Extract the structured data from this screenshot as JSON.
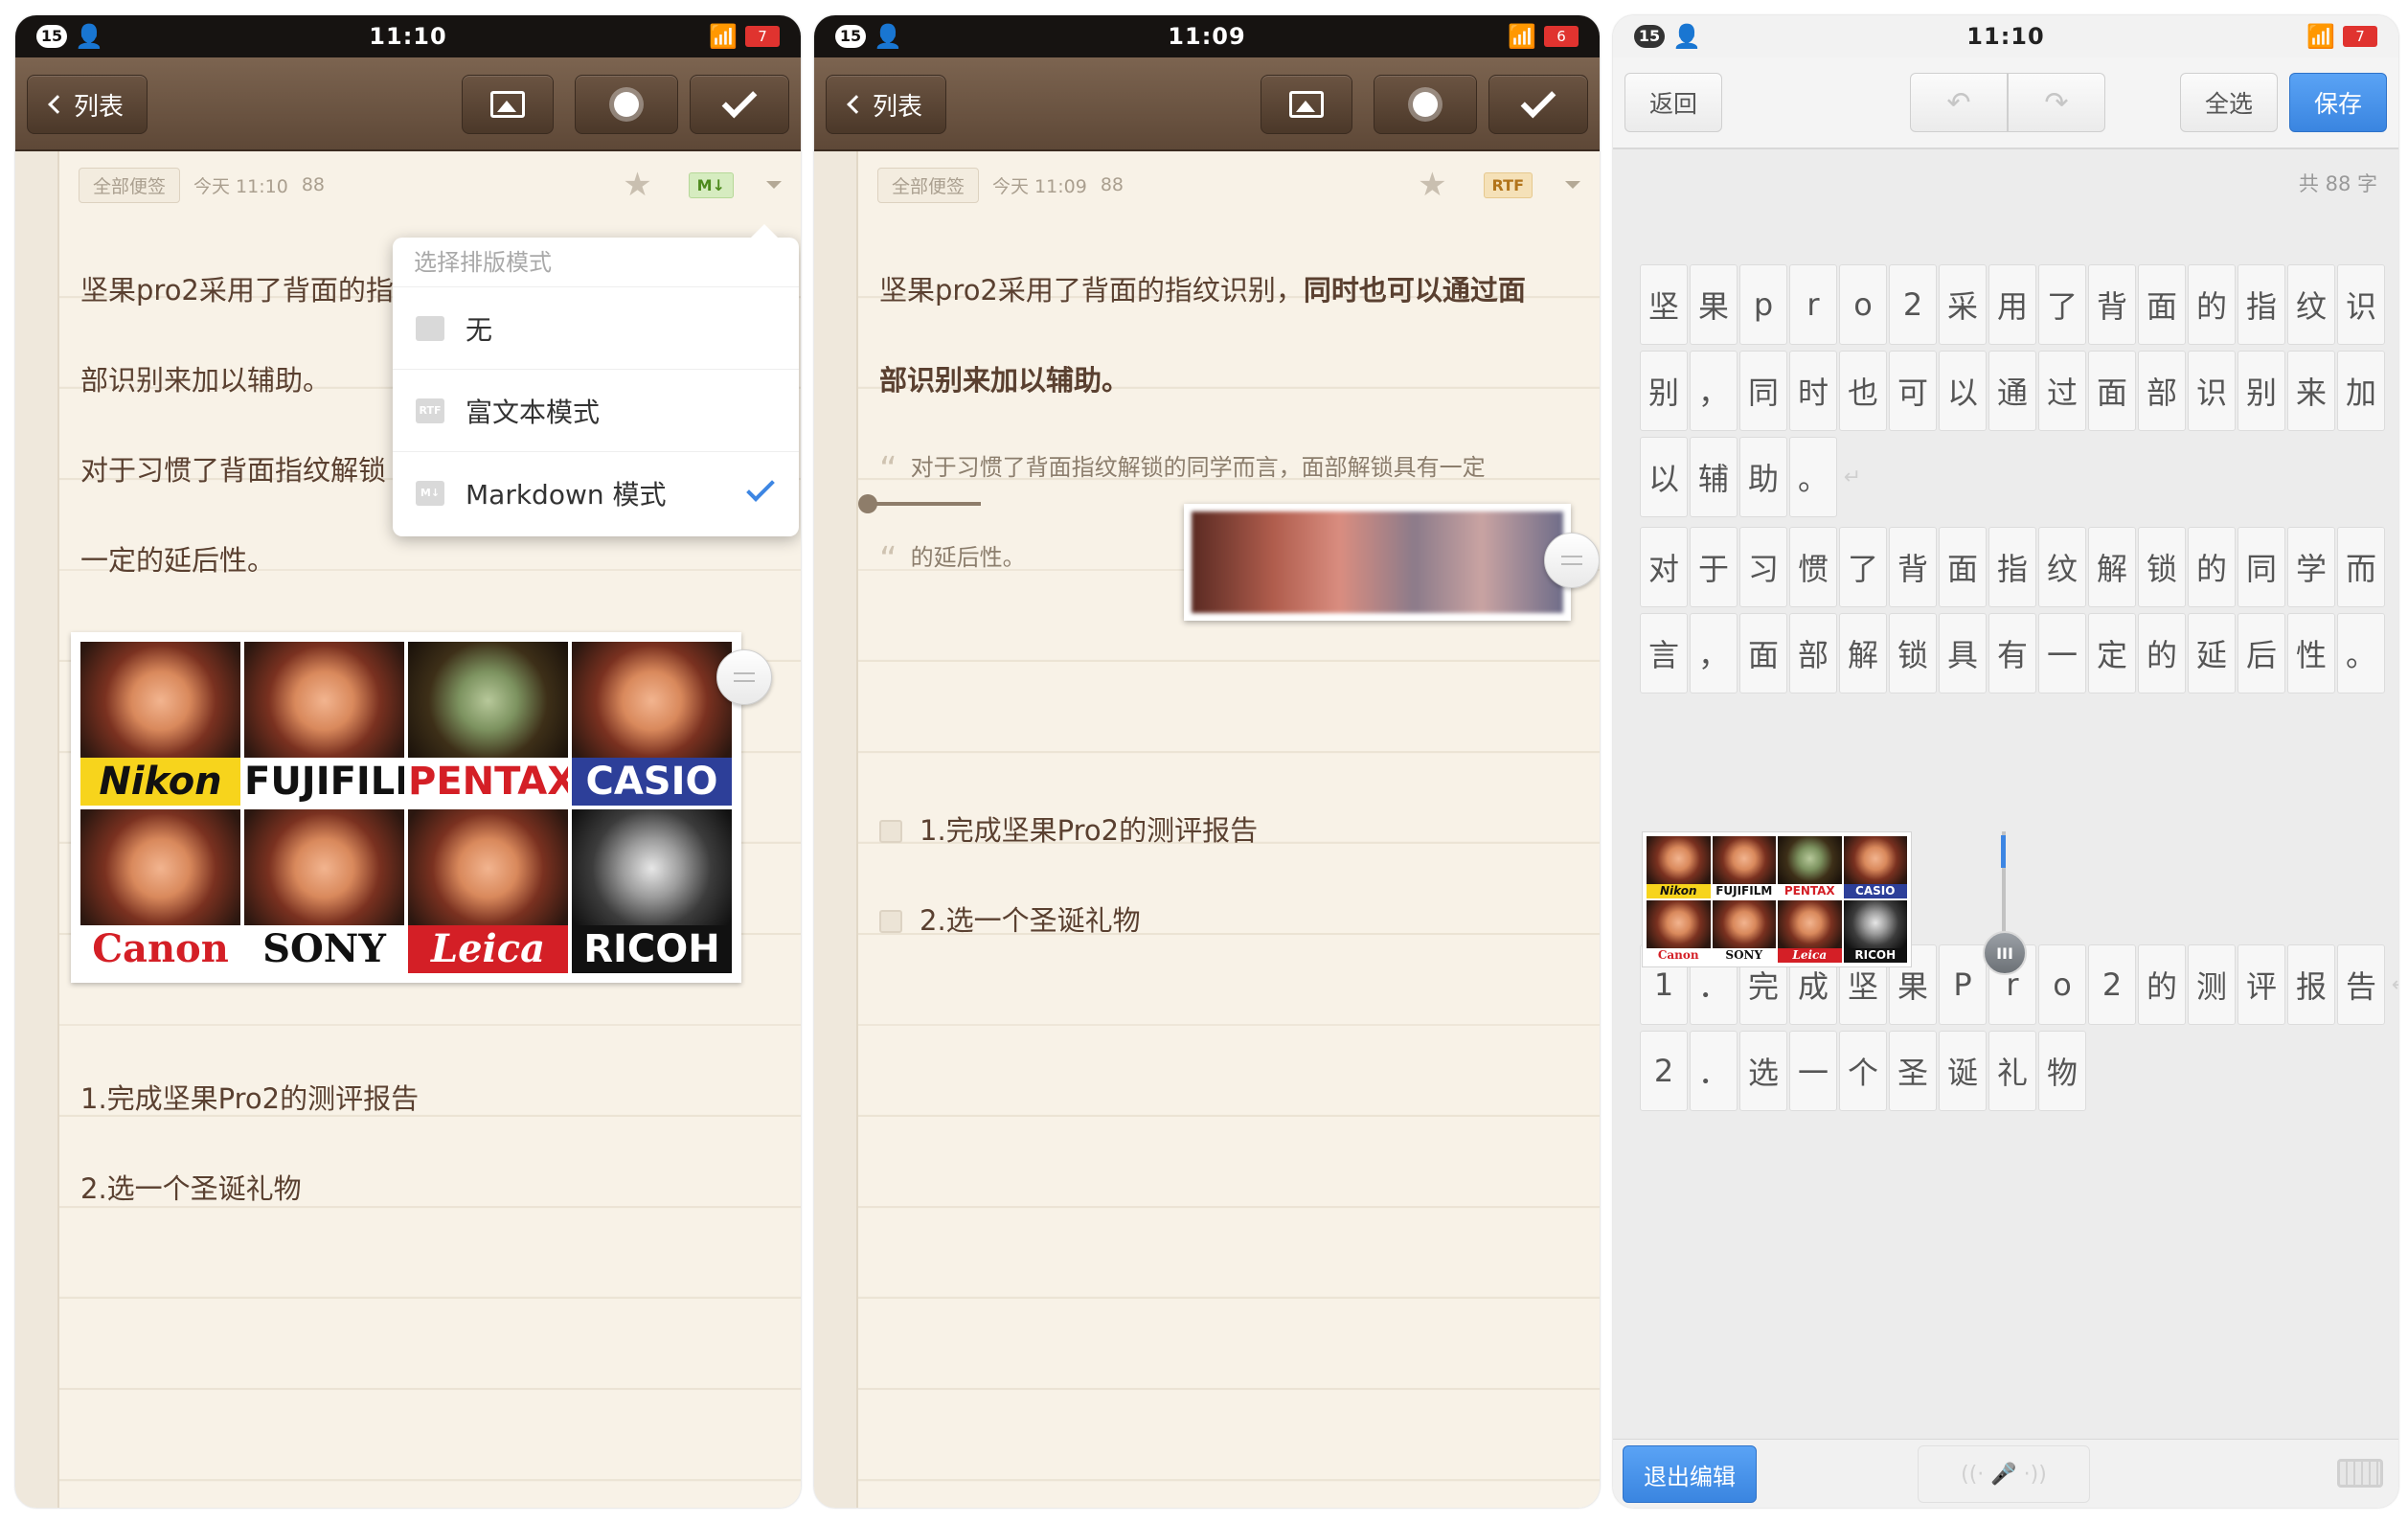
{
  "phone1": {
    "status": {
      "badge": "15",
      "time": "11:10",
      "battery": "7"
    },
    "toolbar": {
      "back_label": "列表"
    },
    "meta": {
      "category": "全部便签",
      "date": "今天 11:10",
      "count": "88",
      "format_badge": "M↓"
    },
    "lines": {
      "l1": "坚果pro2采用了背面的指",
      "l2": "部识别来加以辅助。",
      "l3": "对于习惯了背面指纹解锁",
      "l4": "一定的延后性。",
      "item1": "1.完成坚果Pro2的测评报告",
      "item2": "2.选一个圣诞礼物"
    },
    "popup": {
      "title": "选择排版模式",
      "options": [
        {
          "icon": "",
          "label": "无"
        },
        {
          "icon": "RTF",
          "label": "富文本模式"
        },
        {
          "icon": "M↓",
          "label": "Markdown 模式"
        }
      ]
    },
    "cameras": [
      "Nikon",
      "FUJIFILM",
      "PENTAX",
      "CASIO",
      "Canon",
      "SONY",
      "Leica",
      "RICOH"
    ]
  },
  "phone2": {
    "status": {
      "badge": "15",
      "time": "11:09",
      "battery": "6"
    },
    "toolbar": {
      "back_label": "列表"
    },
    "meta": {
      "category": "全部便签",
      "date": "今天 11:09",
      "count": "88",
      "format_badge": "RTF"
    },
    "lines": {
      "l1_a": "坚果pro2采用了背面的指纹识别，",
      "l1_b": "同时也可以通过面",
      "l2": "部识别来加以辅助。",
      "quote1": "对于习惯了背面指纹解锁的同学而言，面部解锁具有一定",
      "quote2": "的延后性。",
      "todo1": "1.完成坚果Pro2的测评报告",
      "todo2": "2.选一个圣诞礼物"
    }
  },
  "phone3": {
    "status": {
      "badge": "15",
      "time": "11:10",
      "battery": "7"
    },
    "toolbar": {
      "back_label": "返回",
      "select_all_label": "全选",
      "save_label": "保存",
      "undo_icon": "↶",
      "redo_icon": "↷"
    },
    "count_label": "共 88 字",
    "rows": [
      [
        "坚",
        "果",
        "p",
        "r",
        "o",
        "2",
        "采",
        "用",
        "了",
        "背",
        "面",
        "的",
        "指",
        "纹",
        "识"
      ],
      [
        "别",
        "，",
        "同",
        "时",
        "也",
        "可",
        "以",
        "通",
        "过",
        "面",
        "部",
        "识",
        "别",
        "来",
        "加"
      ],
      [
        "以",
        "辅",
        "助",
        "。",
        "↵"
      ],
      [
        "对",
        "于",
        "习",
        "惯",
        "了",
        "背",
        "面",
        "指",
        "纹",
        "解",
        "锁",
        "的",
        "同",
        "学",
        "而"
      ],
      [
        "言",
        "，",
        "面",
        "部",
        "解",
        "锁",
        "具",
        "有",
        "一",
        "定",
        "的",
        "延",
        "后",
        "性",
        "。"
      ],
      [
        "1",
        "．",
        "完",
        "成",
        "坚",
        "果",
        "P",
        "r",
        "o",
        "2",
        "的",
        "测",
        "评",
        "报",
        "告",
        "↵"
      ],
      [
        "2",
        "．",
        "选",
        "一",
        "个",
        "圣",
        "诞",
        "礼",
        "物"
      ]
    ],
    "knob_glyph": "III",
    "bottom": {
      "exit_label": "退出编辑",
      "mic_label": "((· 🎤 ·))"
    }
  },
  "colors": {
    "accent_blue": "#3d86e3",
    "wood": "#6b5442",
    "paper": "#f8f2e7",
    "ink": "#5a4030"
  }
}
